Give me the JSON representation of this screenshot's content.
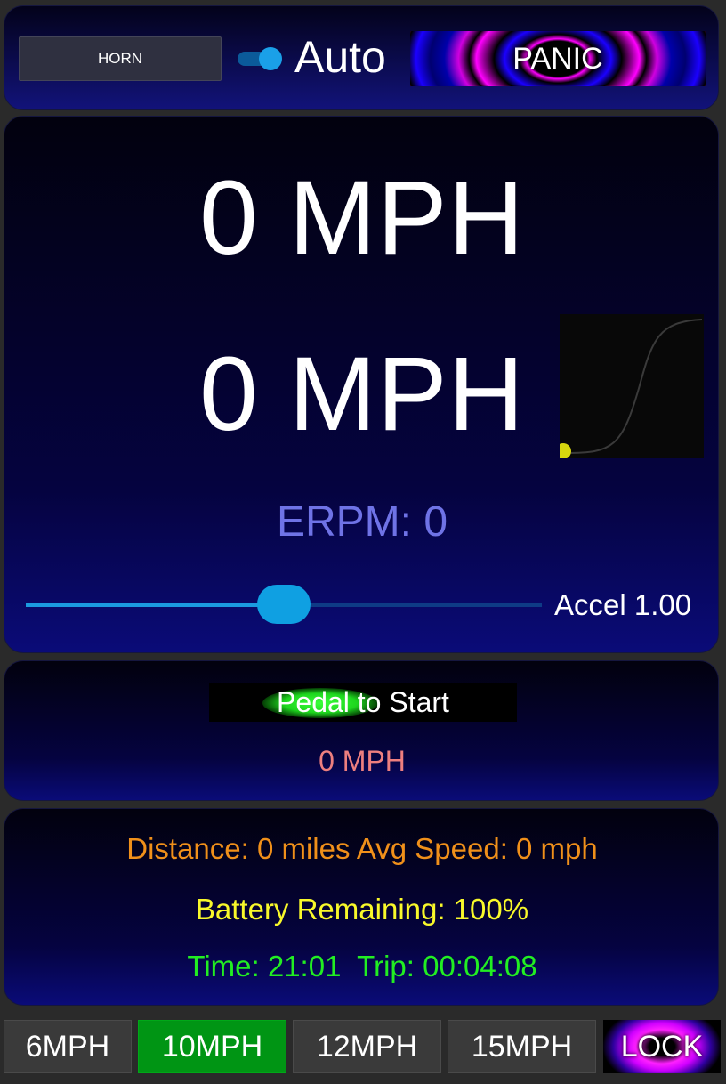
{
  "top_bar": {
    "horn_label": "HORN",
    "auto_toggle_on": true,
    "auto_label": "Auto",
    "panic_label": "PANIC"
  },
  "main": {
    "speed_primary": "0 MPH",
    "speed_secondary": "0 MPH",
    "erpm": "ERPM: 0",
    "accel_slider_fraction": 0.5,
    "accel_label": "Accel 1.00"
  },
  "pedal": {
    "start_label": "Pedal to Start",
    "speed": "0 MPH"
  },
  "stats": {
    "distance": "Distance: 0 miles Avg Speed: 0 mph",
    "battery": "Battery Remaining: 100%",
    "time": "Time: 21:01  Trip: 00:04:08"
  },
  "speed_limits": {
    "btn_6": "6MPH",
    "btn_10": "10MPH",
    "btn_12": "12MPH",
    "btn_15": "15MPH",
    "active": "10MPH",
    "lock_label": "LOCK"
  },
  "colors": {
    "active_limit": "#009514",
    "distance_text": "#f0901a",
    "battery_text": "#f8f82a",
    "time_text": "#22ee22",
    "erpm_text": "#6f73e6",
    "pedal_speed_text": "#ee7f7f",
    "accent_blue": "#0fa0e2"
  }
}
